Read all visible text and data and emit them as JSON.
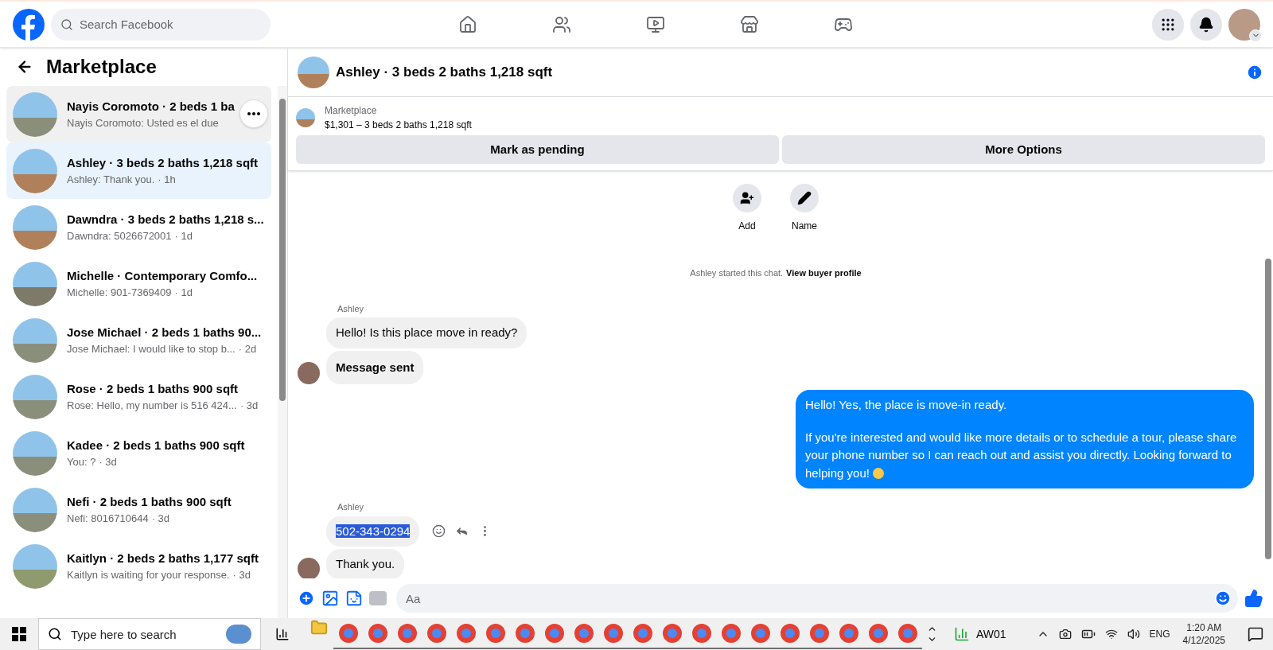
{
  "topbar": {
    "search": {
      "placeholder": "Search Facebook"
    },
    "nav": [
      {
        "selected": false
      },
      {
        "selected": false
      },
      {
        "selected": false
      },
      {
        "selected": false
      },
      {
        "selected": false
      }
    ]
  },
  "sidebar": {
    "title": "Marketplace",
    "conversations": [
      {
        "title": "Nayis Coromoto · 2 beds 1 ba",
        "preview": "Nayis Coromoto: Usted es el due",
        "selected": false,
        "hovered": true
      },
      {
        "title": "Ashley · 3 beds 2 baths 1,218 sqft",
        "preview": "Ashley: Thank you.",
        "time": "· 1h",
        "selected": true,
        "hovered": false
      },
      {
        "title": "Dawndra · 3 beds 2 baths 1,218 s...",
        "preview": "Dawndra: 5026672001",
        "time": "· 1d",
        "selected": false,
        "hovered": false
      },
      {
        "title": "Michelle · Contemporary Comfo...",
        "preview": "Michelle: 901-7369409",
        "time": "· 1d",
        "selected": false,
        "hovered": false
      },
      {
        "title": "Jose Michael · 2 beds 1 baths 90...",
        "preview": "Jose Michael: I would like to stop b...",
        "time": "· 2d",
        "selected": false,
        "hovered": false
      },
      {
        "title": "Rose · 2 beds 1 baths 900 sqft",
        "preview": "Rose: Hello, my number is 516 424...",
        "time": "· 3d",
        "selected": false,
        "hovered": false
      },
      {
        "title": "Kadee · 2 beds 1 baths 900 sqft",
        "preview": "You: ?",
        "time": "· 3d",
        "selected": false,
        "hovered": false
      },
      {
        "title": "Nefi · 2 beds 1 baths 900 sqft",
        "preview": "Nefi: 8016710644",
        "time": "· 3d",
        "selected": false,
        "hovered": false
      },
      {
        "title": "Kaitlyn · 2 beds 2 baths 1,177 sqft",
        "preview": "Kaitlyn is waiting for your response.",
        "time": "· 3d",
        "selected": false,
        "hovered": false
      }
    ]
  },
  "chat": {
    "title": "Ashley · 3 beds 2 baths 1,218 sqft",
    "listing": {
      "label": "Marketplace",
      "summary": "$1,301 – 3 beds 2 baths 1,218 sqft"
    },
    "buttons": [
      "Mark as pending",
      "More Options"
    ],
    "actions": [
      "Add",
      "Name"
    ],
    "started": {
      "text": "Ashley started this chat.",
      "link": "View buyer profile"
    },
    "messages": [
      {
        "kind": "sender",
        "text": "Ashley"
      },
      {
        "kind": "incoming",
        "text": "Hello! Is this place move in ready?",
        "avatar": false,
        "bold": false,
        "highlighted": false
      },
      {
        "kind": "incoming",
        "text": "Message sent",
        "avatar": true,
        "bold": true,
        "highlighted": false
      },
      {
        "kind": "outgoing",
        "paragraphs": [
          "Hello! Yes, the place is move-in ready.",
          "If you're interested and would like more details or to schedule a tour, please share your phone number so I can reach out and assist you directly. Looking forward to helping you!"
        ]
      },
      {
        "kind": "sender",
        "text": "Ashley"
      },
      {
        "kind": "incoming",
        "text": "502-343-0294",
        "avatar": false,
        "bold": false,
        "highlighted": true
      },
      {
        "kind": "incoming",
        "text": "Thank you.",
        "avatar": true,
        "bold": false,
        "highlighted": false
      }
    ],
    "composer": {
      "placeholder": "Aa"
    }
  },
  "taskbar": {
    "search": {
      "placeholder": "Type here to search"
    },
    "network_label": "AW01",
    "language": "ENG",
    "time": "1:20 AM",
    "date": "4/12/2025"
  }
}
